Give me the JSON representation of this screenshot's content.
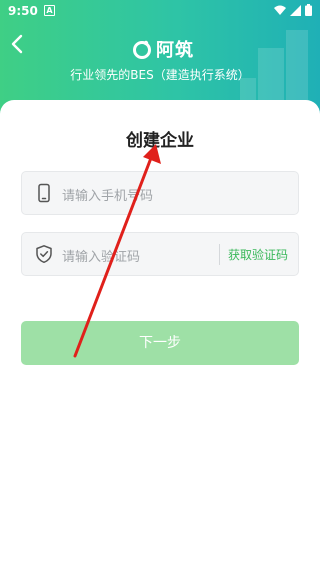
{
  "status_bar": {
    "time": "9:50",
    "notification_glyph": "A"
  },
  "header": {
    "brand_name": "阿筑",
    "subtitle": "行业领先的BES（建造执行系统）",
    "colors": {
      "gradient_start": "#3fcf85",
      "gradient_end": "#1fb0b6"
    }
  },
  "form": {
    "title": "创建企业",
    "phone_placeholder": "请输入手机号码",
    "code_placeholder": "请输入验证码",
    "get_code_label": "获取验证码",
    "next_label": "下一步"
  },
  "icons": {
    "back": "chevron-left-icon",
    "phone": "phone-icon",
    "shield": "shield-check-icon",
    "logo": "logo-icon"
  },
  "accent_color": "#3bb85b",
  "button_color": "#9ee0a6",
  "annotation_color": "#e0201b"
}
